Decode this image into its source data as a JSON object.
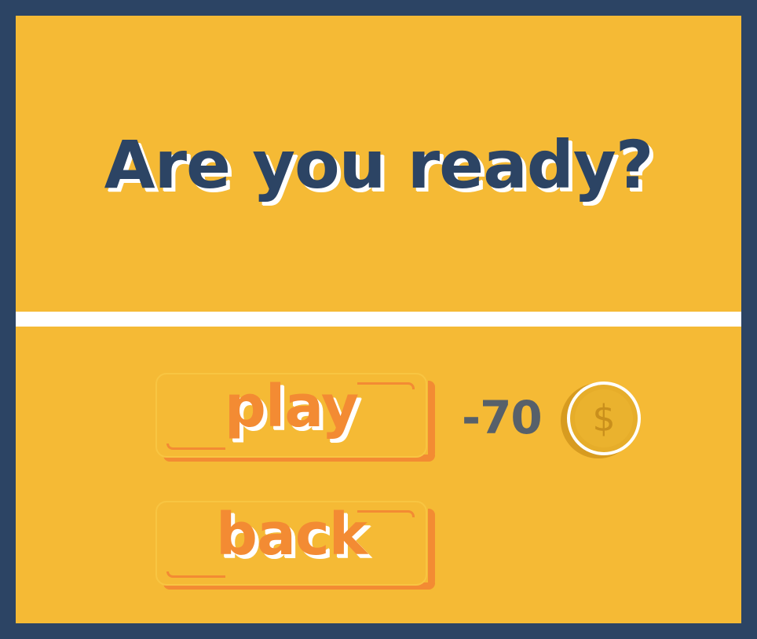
{
  "screen": {
    "title": "Are you ready?"
  },
  "buttons": {
    "play_label": "play",
    "back_label": "back"
  },
  "cost": {
    "value": "-70",
    "currency_icon": "coin-icon",
    "currency_symbol": "$"
  },
  "colors": {
    "background": "#f5ba35",
    "border": "#2c4464",
    "title": "#2c4464",
    "button_text": "#f38b33",
    "cost_text": "#57606a",
    "coin": "#e6ad2a"
  }
}
